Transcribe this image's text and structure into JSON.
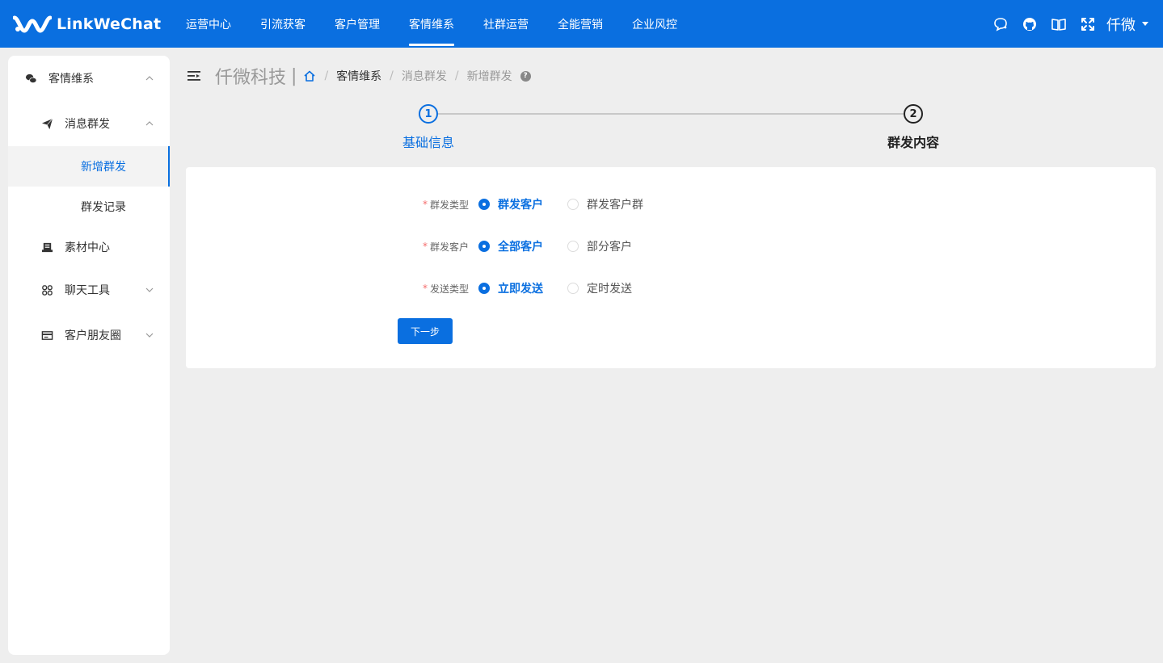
{
  "brand": {
    "name": "LinkWeChat"
  },
  "nav": [
    "运营中心",
    "引流获客",
    "客户管理",
    "客情维系",
    "社群运营",
    "全能营销",
    "企业风控"
  ],
  "nav_active_index": 3,
  "user": {
    "name": "仟微"
  },
  "sidebar": {
    "group": "客情维系",
    "sub_group": "消息群发",
    "items": {
      "new_mass": "新增群发",
      "mass_records": "群发记录",
      "material_center": "素材中心",
      "chat_tools": "聊天工具",
      "moments": "客户朋友圈"
    }
  },
  "header": {
    "company": "仟微科技",
    "divider": "|",
    "breadcrumb": [
      "客情维系",
      "消息群发",
      "新增群发"
    ],
    "help_glyph": "?"
  },
  "steps": [
    {
      "number": "1",
      "title": "基础信息",
      "status": "active"
    },
    {
      "number": "2",
      "title": "群发内容",
      "status": "pending"
    }
  ],
  "form": {
    "rows": [
      {
        "label": "群发类型",
        "required": "*",
        "options": [
          "群发客户",
          "群发客户群"
        ],
        "selected": 0
      },
      {
        "label": "群发客户",
        "required": "*",
        "options": [
          "全部客户",
          "部分客户"
        ],
        "selected": 0
      },
      {
        "label": "发送类型",
        "required": "*",
        "options": [
          "立即发送",
          "定时发送"
        ],
        "selected": 0
      }
    ],
    "next_button": "下一步"
  },
  "colors": {
    "primary": "#0a6fe0",
    "background": "#eeeeee",
    "required": "#f56c6c"
  },
  "icons": {
    "top": [
      "chat-bubble-icon",
      "github-icon",
      "book-icon",
      "fullscreen-icon"
    ],
    "sidebar": [
      "wechat-icon",
      "paper-plane-icon",
      "material-icon",
      "grid-icon",
      "card-icon"
    ]
  }
}
